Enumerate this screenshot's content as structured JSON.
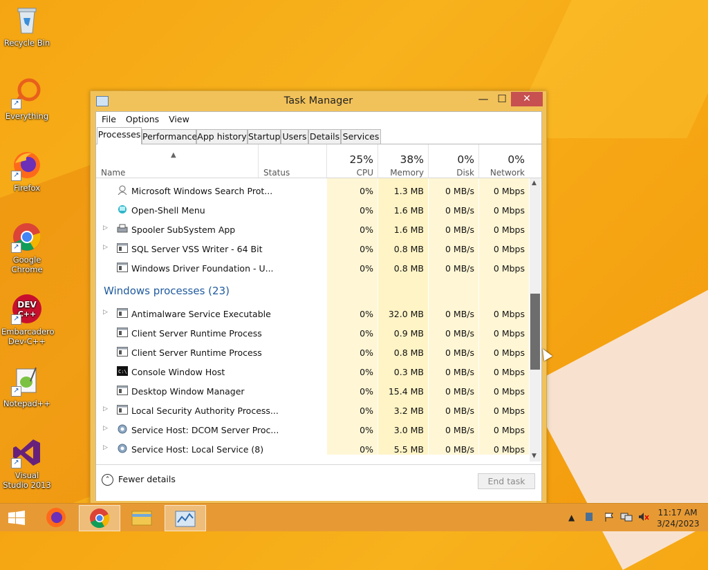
{
  "desktop": {
    "icons": [
      {
        "label": "Recycle Bin"
      },
      {
        "label": "Everything"
      },
      {
        "label": "Firefox"
      },
      {
        "label": "Google Chrome"
      },
      {
        "label": "Embarcadero Dev-C++"
      },
      {
        "label": "Notepad++"
      },
      {
        "label": "Visual Studio 2013"
      }
    ]
  },
  "window": {
    "title": "Task Manager",
    "controls": {
      "minimize": "—",
      "maximize": "☐",
      "close": "✕"
    }
  },
  "menu": {
    "file": "File",
    "options": "Options",
    "view": "View"
  },
  "tabs": [
    "Processes",
    "Performance",
    "App history",
    "Startup",
    "Users",
    "Details",
    "Services"
  ],
  "columns": {
    "name": "Name",
    "status": "Status",
    "cpu": {
      "pct": "25%",
      "label": "CPU"
    },
    "memory": {
      "pct": "38%",
      "label": "Memory"
    },
    "disk": {
      "pct": "0%",
      "label": "Disk"
    },
    "network": {
      "pct": "0%",
      "label": "Network"
    }
  },
  "processes_top": [
    {
      "name": "Microsoft Windows Search Prot...",
      "cpu": "0%",
      "mem": "1.3 MB",
      "disk": "0 MB/s",
      "net": "0 Mbps"
    },
    {
      "name": "Open-Shell Menu",
      "cpu": "0%",
      "mem": "1.6 MB",
      "disk": "0 MB/s",
      "net": "0 Mbps"
    },
    {
      "name": "Spooler SubSystem App",
      "cpu": "0%",
      "mem": "1.6 MB",
      "disk": "0 MB/s",
      "net": "0 Mbps"
    },
    {
      "name": "SQL Server VSS Writer - 64 Bit",
      "cpu": "0%",
      "mem": "0.8 MB",
      "disk": "0 MB/s",
      "net": "0 Mbps"
    },
    {
      "name": "Windows Driver Foundation - U...",
      "cpu": "0%",
      "mem": "0.8 MB",
      "disk": "0 MB/s",
      "net": "0 Mbps"
    }
  ],
  "group_windows": "Windows processes (23)",
  "processes_windows": [
    {
      "name": "Antimalware Service Executable",
      "cpu": "0%",
      "mem": "32.0 MB",
      "disk": "0 MB/s",
      "net": "0 Mbps"
    },
    {
      "name": "Client Server Runtime Process",
      "cpu": "0%",
      "mem": "0.9 MB",
      "disk": "0 MB/s",
      "net": "0 Mbps"
    },
    {
      "name": "Client Server Runtime Process",
      "cpu": "0%",
      "mem": "0.8 MB",
      "disk": "0 MB/s",
      "net": "0 Mbps"
    },
    {
      "name": "Console Window Host",
      "cpu": "0%",
      "mem": "0.3 MB",
      "disk": "0 MB/s",
      "net": "0 Mbps"
    },
    {
      "name": "Desktop Window Manager",
      "cpu": "0%",
      "mem": "15.4 MB",
      "disk": "0 MB/s",
      "net": "0 Mbps"
    },
    {
      "name": "Local Security Authority Process...",
      "cpu": "0%",
      "mem": "3.2 MB",
      "disk": "0 MB/s",
      "net": "0 Mbps"
    },
    {
      "name": "Service Host: DCOM Server Proc...",
      "cpu": "0%",
      "mem": "3.0 MB",
      "disk": "0 MB/s",
      "net": "0 Mbps"
    },
    {
      "name": "Service Host: Local Service (8)",
      "cpu": "0%",
      "mem": "5.5 MB",
      "disk": "0 MB/s",
      "net": "0 Mbps"
    }
  ],
  "footer": {
    "fewer_details": "Fewer details",
    "end_task": "End task"
  },
  "taskbar": {
    "time": "11:17 AM",
    "date": "3/24/2023"
  }
}
